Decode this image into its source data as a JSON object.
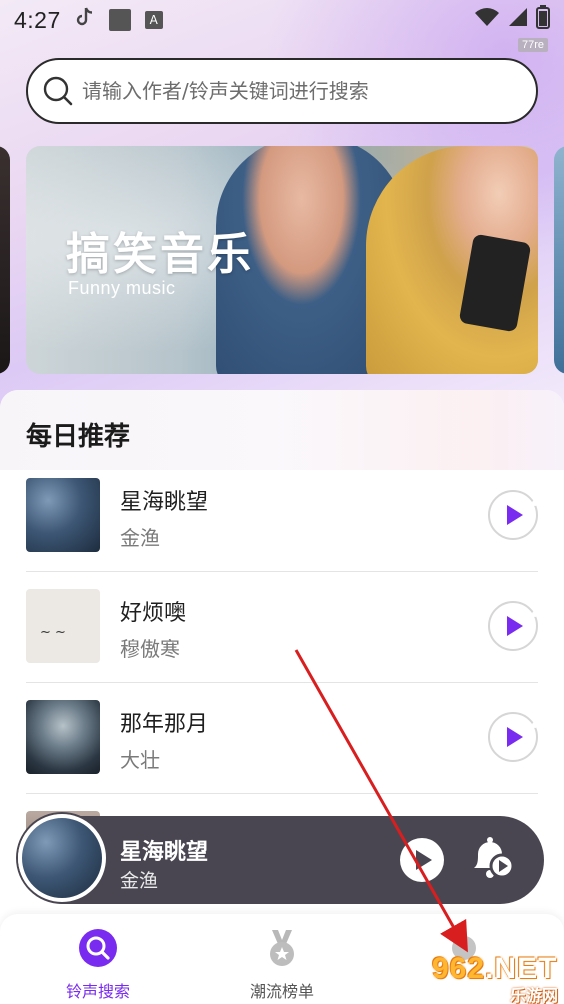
{
  "status_bar": {
    "time": "4:27",
    "badge": "77re"
  },
  "search": {
    "placeholder": "请输入作者/铃声关键词进行搜索"
  },
  "banner": {
    "title": "搞笑音乐",
    "subtitle": "Funny music"
  },
  "recommend": {
    "title": "每日推荐",
    "songs": [
      {
        "name": "星海眺望",
        "artist": "金渔"
      },
      {
        "name": "好烦噢",
        "artist": "穆傲寒"
      },
      {
        "name": "那年那月",
        "artist": "大壮"
      }
    ]
  },
  "now_playing": {
    "title": "星海眺望",
    "artist": "金渔"
  },
  "bottom_nav": {
    "items": [
      {
        "label": "铃声搜索",
        "active": true
      },
      {
        "label": "潮流榜单",
        "active": false
      },
      {
        "label": "",
        "active": false
      }
    ]
  },
  "watermark": {
    "brand_num": "962",
    "brand_suffix": ".NET",
    "text": "乐游网"
  },
  "colors": {
    "accent": "#7a2bf0",
    "player_bg": "#4a4651",
    "annotation_arrow": "#d81e1e"
  }
}
